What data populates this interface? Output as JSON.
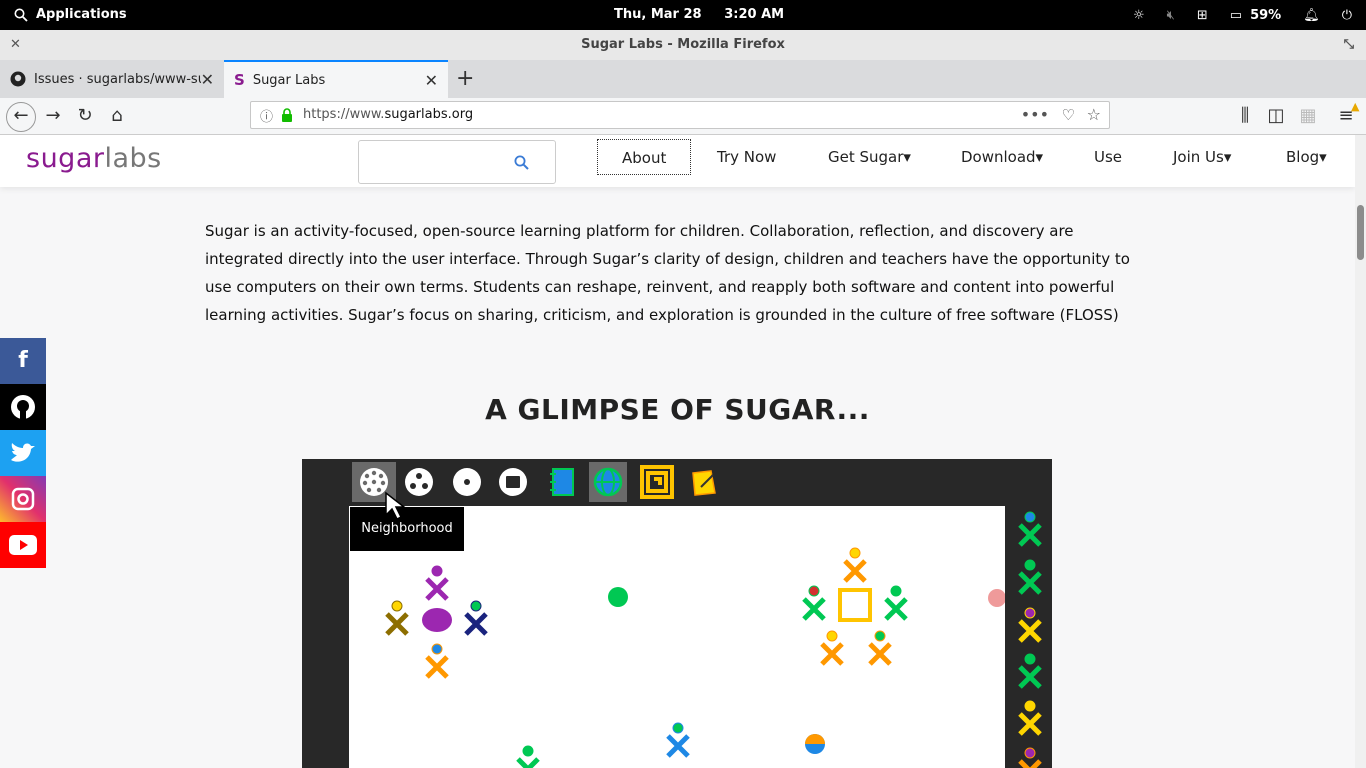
{
  "system": {
    "apps_label": "Applications",
    "date": "Thu, Mar 28",
    "time": "3:20 AM",
    "battery": "59%"
  },
  "window": {
    "title": "Sugar Labs - Mozilla Firefox"
  },
  "tabs": [
    {
      "label": "Issues · sugarlabs/www-sugar",
      "active": false
    },
    {
      "label": "Sugar Labs",
      "active": true
    }
  ],
  "url": {
    "scheme": "https://www.",
    "host": "sugarlabs.org"
  },
  "site": {
    "logo_sugar": "sugar",
    "logo_labs": "labs",
    "nav": [
      "About",
      "Try Now",
      "Get Sugar▾",
      "Download▾",
      "Use",
      "Join Us▾",
      "Blog▾"
    ],
    "intro": "Sugar is an activity-focused, open-source learning platform for children. Collaboration, reflection, and discovery are integrated directly into the user interface. Through Sugar’s clarity of design, children and teachers have the opportunity to use computers on their own terms. Students can reshape, reinvent, and reapply both software and content into powerful learning activities. Sugar’s focus on sharing, criticism, and exploration is grounded in the culture of free software (FLOSS)",
    "glimpse_heading": "A GLIMPSE OF SUGAR...",
    "tooltip": "Neighborhood"
  },
  "social": [
    {
      "name": "facebook",
      "glyph": "f",
      "color": "#3b5998"
    },
    {
      "name": "github",
      "glyph": "◉",
      "color": "#000000"
    },
    {
      "name": "twitter",
      "glyph": "✦",
      "color": "#1da1f2"
    },
    {
      "name": "instagram",
      "glyph": "◎",
      "color": "#c13584"
    },
    {
      "name": "youtube",
      "glyph": "▶",
      "color": "#ff0000"
    }
  ]
}
